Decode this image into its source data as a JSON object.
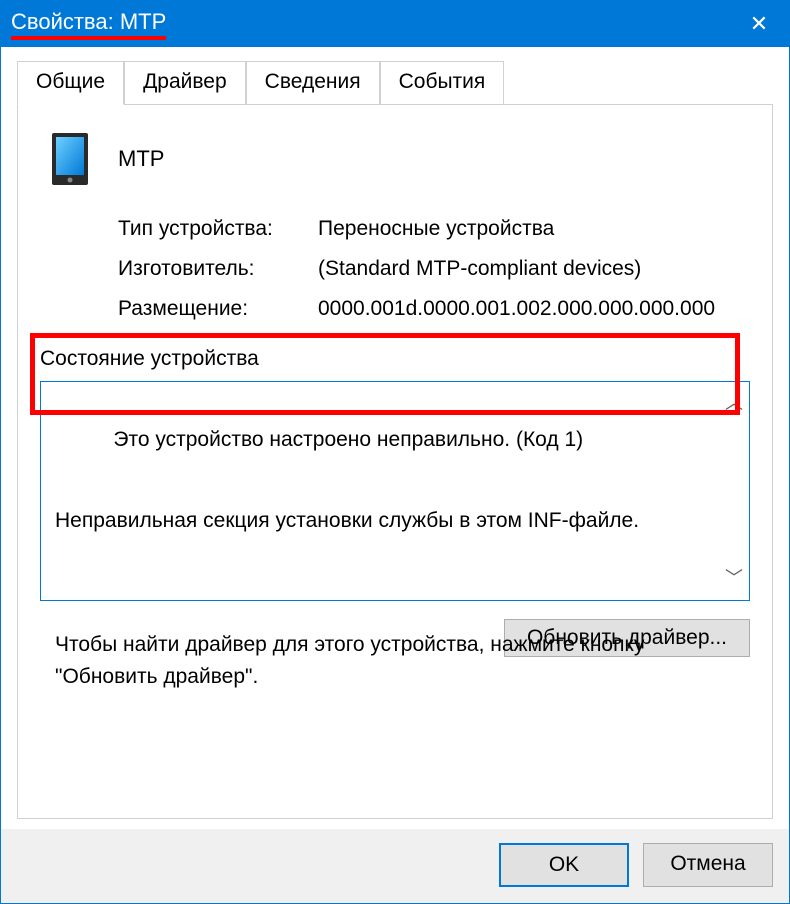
{
  "titlebar": {
    "title": "Свойства: MTP",
    "close_glyph": "✕"
  },
  "tabs": {
    "items": [
      {
        "label": "Общие"
      },
      {
        "label": "Драйвер"
      },
      {
        "label": "Сведения"
      },
      {
        "label": "События"
      }
    ]
  },
  "general": {
    "device_name": "MTP",
    "rows": {
      "type_label": "Тип устройства:",
      "type_value": "Переносные устройства",
      "mfg_label": "Изготовитель:",
      "mfg_value": "(Standard MTP-compliant devices)",
      "loc_label": "Размещение:",
      "loc_value": "0000.001d.0000.001.002.000.000.000.000"
    },
    "status": {
      "group_label": "Состояние устройства",
      "line1": "Это устройство настроено неправильно. (Код 1)",
      "line2": "Неправильная секция установки службы в этом INF-файле.",
      "line3": "Чтобы найти драйвер для этого устройства, нажмите кнопку \"Обновить драйвер\"."
    },
    "update_button": "Обновить драйвер..."
  },
  "footer": {
    "ok": "OK",
    "cancel": "Отмена"
  },
  "icons": {
    "scroll_up": "︿",
    "scroll_down": "﹀"
  }
}
